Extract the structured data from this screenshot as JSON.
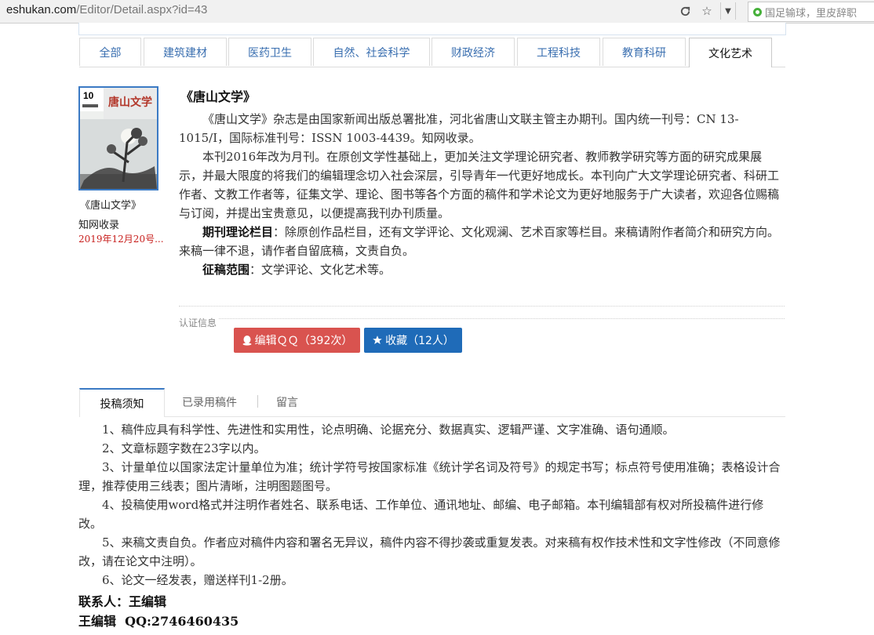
{
  "browser": {
    "url_host": "eshukan.com",
    "url_path": "/Editor/Detail.aspx?id=43",
    "search_text": "国足输球，里皮辞职"
  },
  "categories": [
    {
      "label": "全部",
      "active": false
    },
    {
      "label": "建筑建材",
      "active": false
    },
    {
      "label": "医药卫生",
      "active": false
    },
    {
      "label": "自然、社会科学",
      "active": false
    },
    {
      "label": "财政经济",
      "active": false
    },
    {
      "label": "工程科技",
      "active": false
    },
    {
      "label": "教育科研",
      "active": false
    },
    {
      "label": "文化艺术",
      "active": true
    }
  ],
  "journal_card": {
    "cover_number": "10",
    "cover_title": "唐山文学",
    "title": "《唐山文学》",
    "index": "知网收录",
    "date": "2019年12月20号..."
  },
  "article": {
    "title": "《唐山文学》",
    "para1": "《唐山文学》杂志是由国家新闻出版总署批准，河北省唐山文联主管主办期刊。国内统一刊号：CN 13-1015/I，国际标准刊号：ISSN 1003-4439。知网收录。",
    "para2": "本刊2016年改为月刊。在原创文学性基础上，更加关注文学理论研究者、教师教学研究等方面的研究成果展示，并最大限度的将我们的编辑理念切入社会深层，引导青年一代更好地成长。本刊向广大文学理论研究者、科研工作者、文教工作者等，征集文学、理论、图书等各个方面的稿件和学术论文为更好地服务于广大读者，欢迎各位赐稿与订阅，并提出宝贵意见，以便提高我刊办刊质量。",
    "columns_label": "期刊理论栏目",
    "columns_text": "：除原创作品栏目，还有文学评论、文化观澜、艺术百家等栏目。来稿请附作者简介和研究方向。来稿一律不退，请作者自留底稿，文责自负。",
    "scope_label": "征稿范围",
    "scope_text": "：文学评论、文化艺术等。"
  },
  "cert_label": "认证信息",
  "buttons": {
    "qq": "编辑ＱＱ（392次）",
    "fav": "收藏（12人）"
  },
  "bottom_tabs": [
    "投稿须知",
    "已录用稿件",
    "留言"
  ],
  "rules": [
    "1、稿件应具有科学性、先进性和实用性，论点明确、论据充分、数据真实、逻辑严谨、文字准确、语句通顺。",
    "2、文章标题字数在23字以内。",
    "3、计量单位以国家法定计量单位为准；统计学符号按国家标准《统计学名词及符号》的规定书写；标点符号使用准确；表格设计合理，推荐使用三线表；图片清晰，注明图题图号。",
    "4、投稿使用word格式并注明作者姓名、联系电话、工作单位、通讯地址、邮编、电子邮箱。本刊编辑部有权对所投稿件进行修改。",
    "5、来稿文责自负。作者应对稿件内容和署名无异议，稿件内容不得抄袭或重复发表。对来稿有权作技术性和文字性修改（不同意修改，请在论文中注明）。",
    "6、论文一经发表，赠送样刊1-2册。"
  ],
  "contact": {
    "line1": "联系人：王编辑",
    "line2": "王编辑  QQ:2746460435"
  },
  "colors": {
    "accent": "#3b7ac4",
    "qq_button": "#d9534f",
    "fav_button": "#1f6bb8",
    "date": "#c8201e"
  },
  "icons": [
    "reload-icon",
    "star-icon",
    "dropdown-icon",
    "search-engine-icon",
    "qq-penguin-icon",
    "star-fav-icon"
  ]
}
